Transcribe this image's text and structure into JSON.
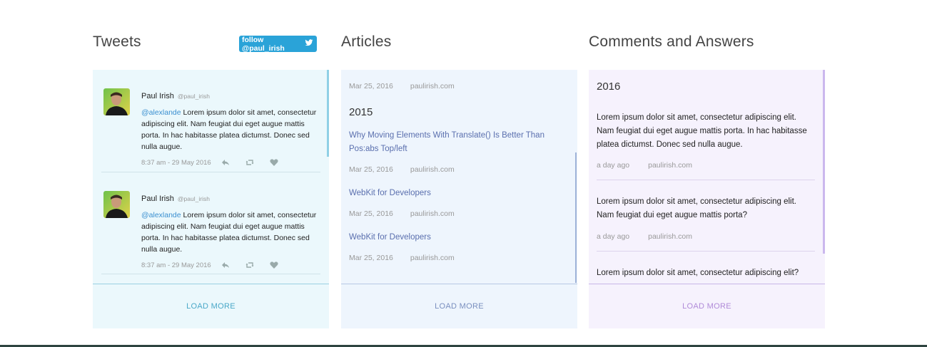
{
  "tweets": {
    "title": "Tweets",
    "follow_label": "follow @paul_irish",
    "items": [
      {
        "name": "Paul Irish",
        "handle": "@paul_irish",
        "mention": "@alexlande",
        "body": " Lorem ipsum dolor sit amet, consectetur adipiscing elit. Nam feugiat dui eget augue mattis porta. In hac habitasse platea dictumst. Donec sed nulla augue.",
        "time": "8:37 am - 29 May 2016"
      },
      {
        "name": "Paul Irish",
        "handle": "@paul_irish",
        "mention": "@alexlande",
        "body": " Lorem ipsum dolor sit amet, consectetur adipiscing elit. Nam feugiat dui eget augue mattis porta. In hac habitasse platea dictumst. Donec sed nulla augue.",
        "time": "8:37 am - 29 May 2016"
      }
    ],
    "load_more": "LOAD MORE"
  },
  "articles": {
    "title": "Articles",
    "top_meta": {
      "date": "Mar 25, 2016",
      "site": "paulirish.com"
    },
    "year": "2015",
    "items": [
      {
        "title": "Why Moving Elements With Translate() Is Better Than Pos:abs Top/left",
        "date": "Mar 25, 2016",
        "site": "paulirish.com"
      },
      {
        "title": "WebKit for Developers",
        "date": "Mar 25, 2016",
        "site": "paulirish.com"
      },
      {
        "title": "WebKit for Developers",
        "date": "Mar 25, 2016",
        "site": "paulirish.com"
      }
    ],
    "load_more": "LOAD MORE"
  },
  "comments": {
    "title": "Comments and Answers",
    "year": "2016",
    "items": [
      {
        "text": "Lorem ipsum dolor sit amet, consectetur adipiscing elit. Nam feugiat dui eget augue mattis porta. In hac habitasse platea dictumst. Donec sed nulla augue.",
        "time": "a day ago",
        "site": "paulirish.com"
      },
      {
        "text": "Lorem ipsum dolor sit amet, consectetur adipiscing elit. Nam feugiat dui eget augue mattis porta?",
        "time": "a day ago",
        "site": "paulirish.com"
      },
      {
        "text": "Lorem ipsum dolor sit amet, consectetur adipiscing elit?"
      }
    ],
    "load_more": "LOAD MORE"
  },
  "colors": {
    "twitter_blue": "#2aa3d8",
    "tweets_bg": "#ebf8fc",
    "articles_bg": "#eef5fd",
    "comments_bg": "#f6f2fd"
  }
}
